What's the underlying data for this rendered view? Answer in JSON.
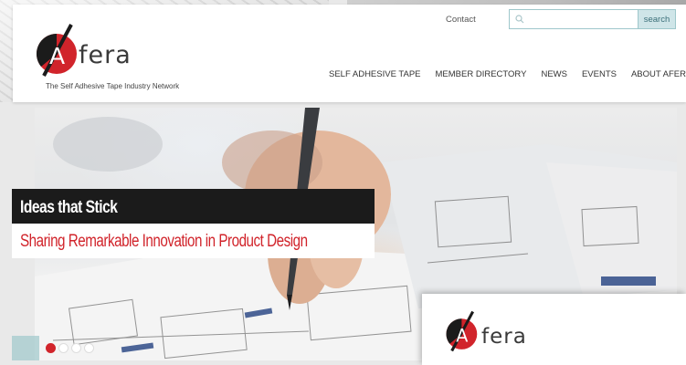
{
  "brand": {
    "logo_letter": "A",
    "logo_word": "fera",
    "tagline": "The Self Adhesive Tape Industry Network",
    "red": "#d1242b",
    "dark": "#1b1b1b"
  },
  "header": {
    "contact_label": "Contact",
    "search": {
      "placeholder": "",
      "button_label": "search",
      "icon": "search-icon"
    },
    "nav": [
      {
        "label": "SELF ADHESIVE TAPE"
      },
      {
        "label": "MEMBER DIRECTORY"
      },
      {
        "label": "NEWS"
      },
      {
        "label": "EVENTS"
      },
      {
        "label": "ABOUT AFERA"
      }
    ]
  },
  "hero": {
    "title": "Ideas that Stick",
    "subtitle": "Sharing Remarkable Innovation in Product Design",
    "slides_total": 4,
    "active_slide": 1
  },
  "overlay": {
    "logo_letter": "A",
    "logo_word": "fera"
  }
}
